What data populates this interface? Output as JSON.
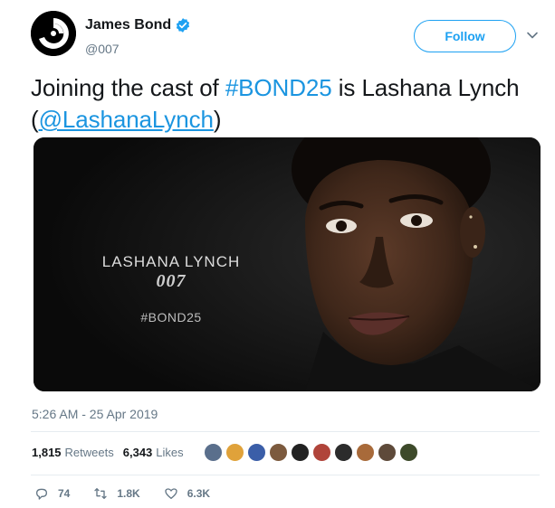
{
  "author": {
    "name": "James Bond",
    "handle": "@007",
    "verified": true
  },
  "follow_label": "Follow",
  "tweet": {
    "text_before": "Joining the cast of ",
    "hashtag": "#BOND25",
    "text_middle": " is Lashana Lynch (",
    "mention": "@LashanaLynch",
    "text_after": ")"
  },
  "media": {
    "name": "LASHANA LYNCH",
    "logo": "007",
    "hashtag": "#BOND25"
  },
  "timestamp": "5:26 AM - 25 Apr 2019",
  "stats": {
    "retweets_count": "1,815",
    "retweets_label": "Retweets",
    "likes_count": "6,343",
    "likes_label": "Likes"
  },
  "actions": {
    "replies": "74",
    "retweets": "1.8K",
    "likes": "6.3K"
  },
  "colors": {
    "accent": "#1da1f2",
    "link": "#1b95e0",
    "muted": "#657786",
    "text": "#14171a",
    "divider": "#e6ecf0"
  },
  "icons": [
    "gun-barrel-avatar-icon",
    "verified-badge-icon",
    "chevron-down-icon",
    "reply-icon",
    "retweet-icon",
    "heart-icon"
  ],
  "liker_avatar_colors": [
    "#5a6f8c",
    "#e0a23a",
    "#3b5ea8",
    "#7c5a3e",
    "#222222",
    "#b0443a",
    "#2c2c2c",
    "#a86a3a",
    "#5e4a3a",
    "#3d4a2a"
  ]
}
